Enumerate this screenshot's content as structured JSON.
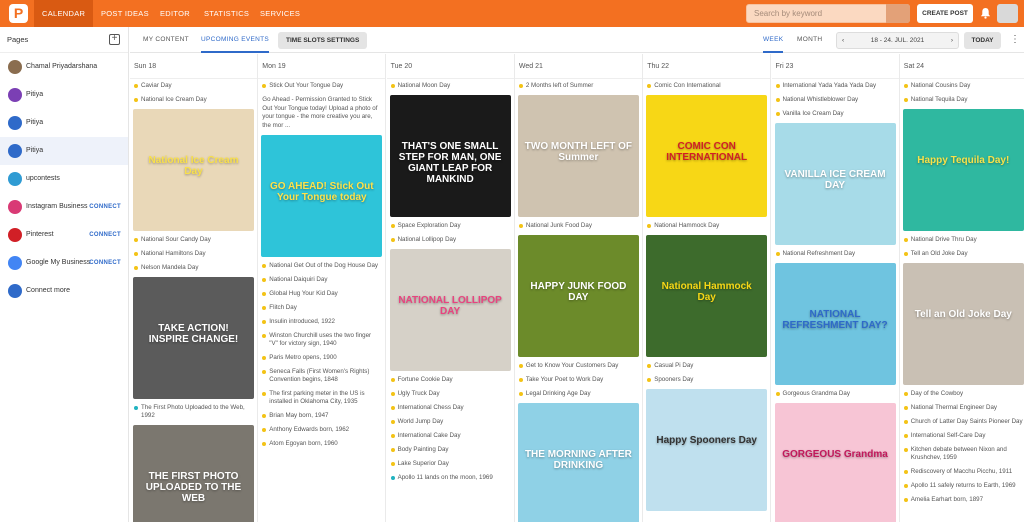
{
  "nav": {
    "items": [
      "CALENDAR",
      "POST IDEAS",
      "EDITOR",
      "STATISTICS",
      "SERVICES"
    ],
    "active": 0
  },
  "search": {
    "placeholder": "Search by keyword"
  },
  "create_post": "CREATE POST",
  "sidebar": {
    "title": "Pages",
    "accounts": [
      {
        "name": "Chamal Priyadarshana",
        "color": "#8a6d4f",
        "connect": ""
      },
      {
        "name": "Pitiya",
        "color": "#7b3fb4",
        "connect": ""
      },
      {
        "name": "Pitiya",
        "color": "#2f6ac9",
        "connect": ""
      },
      {
        "name": "Pitiya",
        "color": "#2f6ac9",
        "connect": ""
      },
      {
        "name": "upcontests",
        "color": "#2f9bd3",
        "connect": ""
      },
      {
        "name": "Instagram Business",
        "color": "#d93a75",
        "connect": "CONNECT"
      },
      {
        "name": "Pinterest",
        "color": "#d11f26",
        "connect": "CONNECT"
      },
      {
        "name": "Google My Business",
        "color": "#4285f4",
        "connect": "CONNECT"
      },
      {
        "name": "Connect more",
        "color": "#2f6ac9",
        "connect": ""
      }
    ]
  },
  "tabs": {
    "my_content": "MY CONTENT",
    "upcoming": "UPCOMING EVENTS",
    "time_slots": "TIME SLOTS SETTINGS",
    "week": "WEEK",
    "month": "MONTH",
    "date_range": "18 - 24. JUL. 2021",
    "today": "TODAY"
  },
  "columns": [
    {
      "header": "Sun 18",
      "items": [
        {
          "k": "ev",
          "t": "Caviar Day"
        },
        {
          "k": "ev",
          "t": "National Ice Cream Day"
        },
        {
          "k": "img",
          "bg": "#e9d8b8",
          "cap": "National Ice Cream Day",
          "capc": "#f9e04a"
        },
        {
          "k": "ev",
          "t": "National Sour Candy Day"
        },
        {
          "k": "ev",
          "t": "National Hamiltons Day"
        },
        {
          "k": "ev",
          "t": "Nelson Mandela Day"
        },
        {
          "k": "img",
          "bg": "#5b5b5b",
          "cap": "TAKE ACTION! INSPIRE CHANGE!",
          "capc": "#ffffff"
        },
        {
          "k": "ev",
          "t": "The First Photo Uploaded to the Web, 1992",
          "teal": true
        },
        {
          "k": "img",
          "bg": "#7b776f",
          "cap": "THE FIRST PHOTO UPLOADED TO THE WEB",
          "capc": "#ffffff"
        }
      ]
    },
    {
      "header": "Mon 19",
      "items": [
        {
          "k": "ev",
          "t": "Stick Out Your Tongue Day"
        },
        {
          "k": "txt",
          "t": "Go Ahead - Permission Granted to Stick Out Your Tongue today! Upload a photo of your tongue - the more creative you are, the mor ..."
        },
        {
          "k": "img",
          "bg": "#2ec4d9",
          "cap": "GO AHEAD! Stick Out Your Tongue today",
          "capc": "#ffe24a"
        },
        {
          "k": "ev",
          "t": "National Get Out of the Dog House Day"
        },
        {
          "k": "ev",
          "t": "National Daiquiri Day"
        },
        {
          "k": "ev",
          "t": "Global Hug Your Kid Day"
        },
        {
          "k": "ev",
          "t": "Flitch Day"
        },
        {
          "k": "ev",
          "t": "Insulin introduced, 1922"
        },
        {
          "k": "ev",
          "t": "Winston Churchill uses the two finger \"V\" for victory sign, 1940"
        },
        {
          "k": "ev",
          "t": "Paris Metro opens, 1900"
        },
        {
          "k": "ev",
          "t": "Seneca Falls (First Women's Rights) Convention begins, 1848"
        },
        {
          "k": "ev",
          "t": "The first parking meter in the US is installed in Oklahoma City, 1935"
        },
        {
          "k": "ev",
          "t": "Brian May born, 1947"
        },
        {
          "k": "ev",
          "t": "Anthony Edwards born, 1962"
        },
        {
          "k": "ev",
          "t": "Atom Egoyan born, 1960"
        }
      ]
    },
    {
      "header": "Tue 20",
      "items": [
        {
          "k": "ev",
          "t": "National Moon Day"
        },
        {
          "k": "img",
          "bg": "#1a1a1a",
          "cap": "THAT'S ONE SMALL STEP FOR MAN, ONE GIANT LEAP FOR MANKIND",
          "capc": "#ffffff"
        },
        {
          "k": "ev",
          "t": "Space Exploration Day"
        },
        {
          "k": "ev",
          "t": "National Lollipop Day"
        },
        {
          "k": "img",
          "bg": "#d6d1c8",
          "cap": "NATIONAL LOLLIPOP DAY",
          "capc": "#e8447f"
        },
        {
          "k": "ev",
          "t": "Fortune Cookie Day"
        },
        {
          "k": "ev",
          "t": "Ugly Truck Day"
        },
        {
          "k": "ev",
          "t": "International Chess Day"
        },
        {
          "k": "ev",
          "t": "World Jump Day"
        },
        {
          "k": "ev",
          "t": "International Cake Day"
        },
        {
          "k": "ev",
          "t": "Body Painting Day"
        },
        {
          "k": "ev",
          "t": "Lake Superior Day"
        },
        {
          "k": "ev",
          "t": "Apollo 11 lands on the moon, 1969",
          "teal": true
        }
      ]
    },
    {
      "header": "Wed 21",
      "items": [
        {
          "k": "ev",
          "t": "2 Months left of Summer"
        },
        {
          "k": "img",
          "bg": "#cfc3b0",
          "cap": "TWO MONTH LEFT OF Summer",
          "capc": "#ffffff"
        },
        {
          "k": "ev",
          "t": "National Junk Food Day"
        },
        {
          "k": "img",
          "bg": "#6c8b2a",
          "cap": "HAPPY JUNK FOOD DAY",
          "capc": "#ffffff"
        },
        {
          "k": "ev",
          "t": "Get to Know Your Customers Day"
        },
        {
          "k": "ev",
          "t": "Take Your Poet to Work Day"
        },
        {
          "k": "ev",
          "t": "Legal Drinking Age Day"
        },
        {
          "k": "img",
          "bg": "#8fd1e6",
          "cap": "THE MORNING AFTER DRINKING",
          "capc": "#ffffff"
        }
      ]
    },
    {
      "header": "Thu 22",
      "items": [
        {
          "k": "ev",
          "t": "Comic Con International"
        },
        {
          "k": "img",
          "bg": "#f7d716",
          "cap": "COMIC CON INTERNATIONAL",
          "capc": "#d11f26"
        },
        {
          "k": "ev",
          "t": "National Hammock Day"
        },
        {
          "k": "img",
          "bg": "#3d6b2c",
          "cap": "National Hammock Day",
          "capc": "#f7d716"
        },
        {
          "k": "ev",
          "t": "Casual Pi Day"
        },
        {
          "k": "ev",
          "t": "Spooners Day"
        },
        {
          "k": "img",
          "bg": "#bfe0ee",
          "cap": "Happy Spooners Day",
          "capc": "#333333"
        }
      ]
    },
    {
      "header": "Fri 23",
      "items": [
        {
          "k": "ev",
          "t": "International Yada Yada Yada Day"
        },
        {
          "k": "ev",
          "t": "National Whistleblower Day"
        },
        {
          "k": "ev",
          "t": "Vanilla Ice Cream Day"
        },
        {
          "k": "img",
          "bg": "#a7dbe8",
          "cap": "VANILLA ICE CREAM DAY",
          "capc": "#ffffff"
        },
        {
          "k": "ev",
          "t": "National Refreshment Day"
        },
        {
          "k": "img",
          "bg": "#6fc4e0",
          "cap": "NATIONAL REFRESHMENT DAY?",
          "capc": "#2f6ac9"
        },
        {
          "k": "ev",
          "t": "Gorgeous Grandma Day"
        },
        {
          "k": "img",
          "bg": "#f7c5d5",
          "cap": "GORGEOUS Grandma",
          "capc": "#c2185b"
        }
      ]
    },
    {
      "header": "Sat 24",
      "items": [
        {
          "k": "ev",
          "t": "National Cousins Day"
        },
        {
          "k": "ev",
          "t": "National Tequila Day"
        },
        {
          "k": "img",
          "bg": "#2fb8a0",
          "cap": "Happy Tequila Day!",
          "capc": "#f7e24a"
        },
        {
          "k": "ev",
          "t": "National Drive Thru Day"
        },
        {
          "k": "ev",
          "t": "Tell an Old Joke Day"
        },
        {
          "k": "img",
          "bg": "#c9c0b4",
          "cap": "Tell an Old Joke Day",
          "capc": "#ffffff"
        },
        {
          "k": "ev",
          "t": "Day of the Cowboy"
        },
        {
          "k": "ev",
          "t": "National Thermal Engineer Day"
        },
        {
          "k": "ev",
          "t": "Church of Latter Day Saints Pioneer Day"
        },
        {
          "k": "ev",
          "t": "International Self-Care Day"
        },
        {
          "k": "ev",
          "t": "Kitchen debate between Nixon and Krushchev, 1959"
        },
        {
          "k": "ev",
          "t": "Rediscovery of Macchu Picchu, 1911"
        },
        {
          "k": "ev",
          "t": "Apollo 11 safely returns to Earth, 1969"
        },
        {
          "k": "ev",
          "t": "Amelia Earhart born, 1897"
        }
      ]
    }
  ]
}
